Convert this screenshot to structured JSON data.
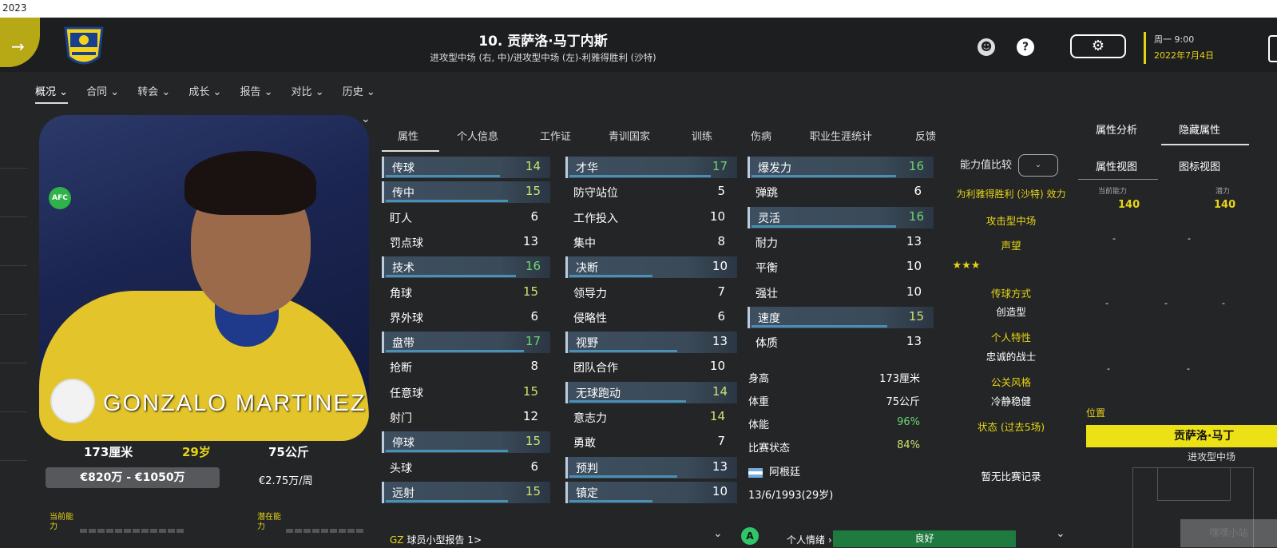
{
  "top_text": "2023",
  "header": {
    "title": "10. 贡萨洛·马丁内斯",
    "subtitle": "进攻型中场 (右, 中)/进攻型中场 (左)-利雅得胜利 (沙特)",
    "help_glyph": "?",
    "settings_glyph": "⚙",
    "day_time": "周一 9:00",
    "date": "2022年7月4日"
  },
  "nav": [
    "概况 ⌄",
    "合同 ⌄",
    "转会 ⌄",
    "成长 ⌄",
    "报告 ⌄",
    "对比 ⌄",
    "历史 ⌄"
  ],
  "player_card": {
    "photo_name": "GONZALO MARTINEZ",
    "height": "173厘米",
    "age": "29岁",
    "weight": "75公斤",
    "value": "€820万 - €1050万",
    "wage": "€2.75万/周",
    "current_ability_label": "当前能力",
    "potential_label": "潜在能力"
  },
  "tabs": [
    "属性",
    "个人信息",
    "工作证",
    "青训国家",
    "训练",
    "伤病",
    "职业生涯统计",
    "反馈"
  ],
  "attributes": {
    "technical": [
      {
        "name": "传球",
        "value": 14,
        "hl": true
      },
      {
        "name": "传中",
        "value": 15,
        "hl": true
      },
      {
        "name": "盯人",
        "value": 6,
        "hl": false
      },
      {
        "name": "罚点球",
        "value": 13,
        "hl": false
      },
      {
        "name": "技术",
        "value": 16,
        "hl": true
      },
      {
        "name": "角球",
        "value": 15,
        "hl": false
      },
      {
        "name": "界外球",
        "value": 6,
        "hl": false
      },
      {
        "name": "盘带",
        "value": 17,
        "hl": true
      },
      {
        "name": "抢断",
        "value": 8,
        "hl": false
      },
      {
        "name": "任意球",
        "value": 15,
        "hl": false
      },
      {
        "name": "射门",
        "value": 12,
        "hl": false
      },
      {
        "name": "停球",
        "value": 15,
        "hl": true
      },
      {
        "name": "头球",
        "value": 6,
        "hl": false
      },
      {
        "name": "远射",
        "value": 15,
        "hl": true
      }
    ],
    "mental": [
      {
        "name": "才华",
        "value": 17,
        "hl": true
      },
      {
        "name": "防守站位",
        "value": 5,
        "hl": false
      },
      {
        "name": "工作投入",
        "value": 10,
        "hl": false
      },
      {
        "name": "集中",
        "value": 8,
        "hl": false
      },
      {
        "name": "决断",
        "value": 10,
        "hl": true
      },
      {
        "name": "领导力",
        "value": 7,
        "hl": false
      },
      {
        "name": "侵略性",
        "value": 6,
        "hl": false
      },
      {
        "name": "视野",
        "value": 13,
        "hl": true
      },
      {
        "name": "团队合作",
        "value": 10,
        "hl": false
      },
      {
        "name": "无球跑动",
        "value": 14,
        "hl": true
      },
      {
        "name": "意志力",
        "value": 14,
        "hl": false
      },
      {
        "name": "勇敢",
        "value": 7,
        "hl": false
      },
      {
        "name": "预判",
        "value": 13,
        "hl": true
      },
      {
        "name": "镇定",
        "value": 10,
        "hl": true
      }
    ],
    "physical": [
      {
        "name": "爆发力",
        "value": 16,
        "hl": true
      },
      {
        "name": "弹跳",
        "value": 6,
        "hl": false
      },
      {
        "name": "灵活",
        "value": 16,
        "hl": true
      },
      {
        "name": "耐力",
        "value": 13,
        "hl": false
      },
      {
        "name": "平衡",
        "value": 10,
        "hl": false
      },
      {
        "name": "强壮",
        "value": 10,
        "hl": false
      },
      {
        "name": "速度",
        "value": 15,
        "hl": true
      },
      {
        "name": "体质",
        "value": 13,
        "hl": false
      }
    ]
  },
  "meta": {
    "height_k": "身高",
    "height_v": "173厘米",
    "weight_k": "体重",
    "weight_v": "75公斤",
    "fitness_k": "体能",
    "fitness_v": "96%",
    "match_k": "比赛状态",
    "match_v": "84%",
    "nation": "阿根廷",
    "dob": "13/6/1993(29岁)"
  },
  "center": {
    "compare": "能力值比较",
    "club_eff": "为利雅得胜利 (沙特) 效力",
    "role": "攻击型中场",
    "reputation": "声望",
    "stars": "★★★",
    "pass_style_k": "传球方式",
    "pass_style_v": "创造型",
    "personality_k": "个人特性",
    "personality_v": "忠诚的战士",
    "media_k": "公关风格",
    "media_v": "冷静稳健",
    "form_k": "状态 (过去5场)",
    "form_v": "暂无比赛记录"
  },
  "right": {
    "tab1": "属性分析",
    "tab2": "隐藏属性",
    "view1": "属性视图",
    "view2": "图标视图",
    "ca_label": "当前能力",
    "ca_value": "140",
    "pa_label": "潜力",
    "pa_value": "140",
    "dash": "-",
    "position_label": "位置",
    "position_name": "贡萨洛·马丁",
    "position_role": "进攻型中场"
  },
  "bottom": {
    "gz": "GZ",
    "report": "球员小型报告 1>",
    "mood_icon": "A",
    "mood": "个人情绪 ›",
    "mood_value": "良好",
    "watermark": "嘿嘿小站"
  }
}
